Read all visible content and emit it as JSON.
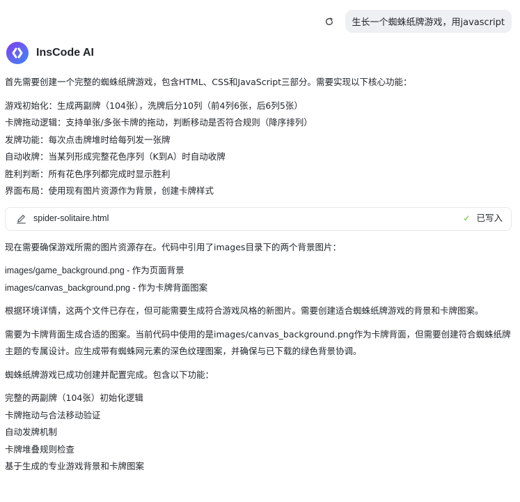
{
  "user_message": {
    "text": "生长一个蜘蛛纸牌游戏，用javascript",
    "retry_icon": "refresh-icon"
  },
  "assistant": {
    "name": "InsCode AI",
    "avatar_icon": "inscode-logo-icon",
    "intro": "首先需要创建一个完整的蜘蛛纸牌游戏，包含HTML、CSS和JavaScript三部分。需要实现以下核心功能：",
    "features": [
      "游戏初始化：生成两副牌（104张），洗牌后分10列（前4列6张，后6列5张）",
      "卡牌拖动逻辑：支持单张/多张卡牌的拖动，判断移动是否符合规则（降序排列）",
      "发牌功能：每次点击牌堆时给每列发一张牌",
      "自动收牌：当某列形成完整花色序列（K到A）时自动收牌",
      "胜利判断：所有花色序列都完成时显示胜利",
      "界面布局：使用现有图片资源作为背景，创建卡牌样式"
    ],
    "file_card": {
      "file_name": "spider-solitaire.html",
      "status": "已写入",
      "edit_icon": "edit-pencil-icon",
      "status_icon": "check-icon"
    },
    "para_images": "现在需要确保游戏所需的图片资源存在。代码中引用了images目录下的两个背景图片：",
    "image_list": [
      "images/game_background.png - 作为页面背景",
      "images/canvas_background.png - 作为卡牌背面图案"
    ],
    "para_env": "根据环境详情，这两个文件已存在，但可能需要生成符合游戏风格的新图片。需要创建适合蜘蛛纸牌游戏的背景和卡牌图案。",
    "para_cardback": "需要为卡牌背面生成合适的图案。当前代码中使用的是images/canvas_background.png作为卡牌背面，但需要创建符合蜘蛛纸牌主题的专属设计。应生成带有蜘蛛网元素的深色纹理图案，并确保与已下载的绿色背景协调。",
    "para_done": "蜘蛛纸牌游戏已成功创建并配置完成。包含以下功能：",
    "done_list": [
      "完整的两副牌（104张）初始化逻辑",
      "卡牌拖动与合法移动验证",
      "自动发牌机制",
      "卡牌堆叠规则检查",
      "基于生成的专业游戏背景和卡牌图案"
    ]
  }
}
